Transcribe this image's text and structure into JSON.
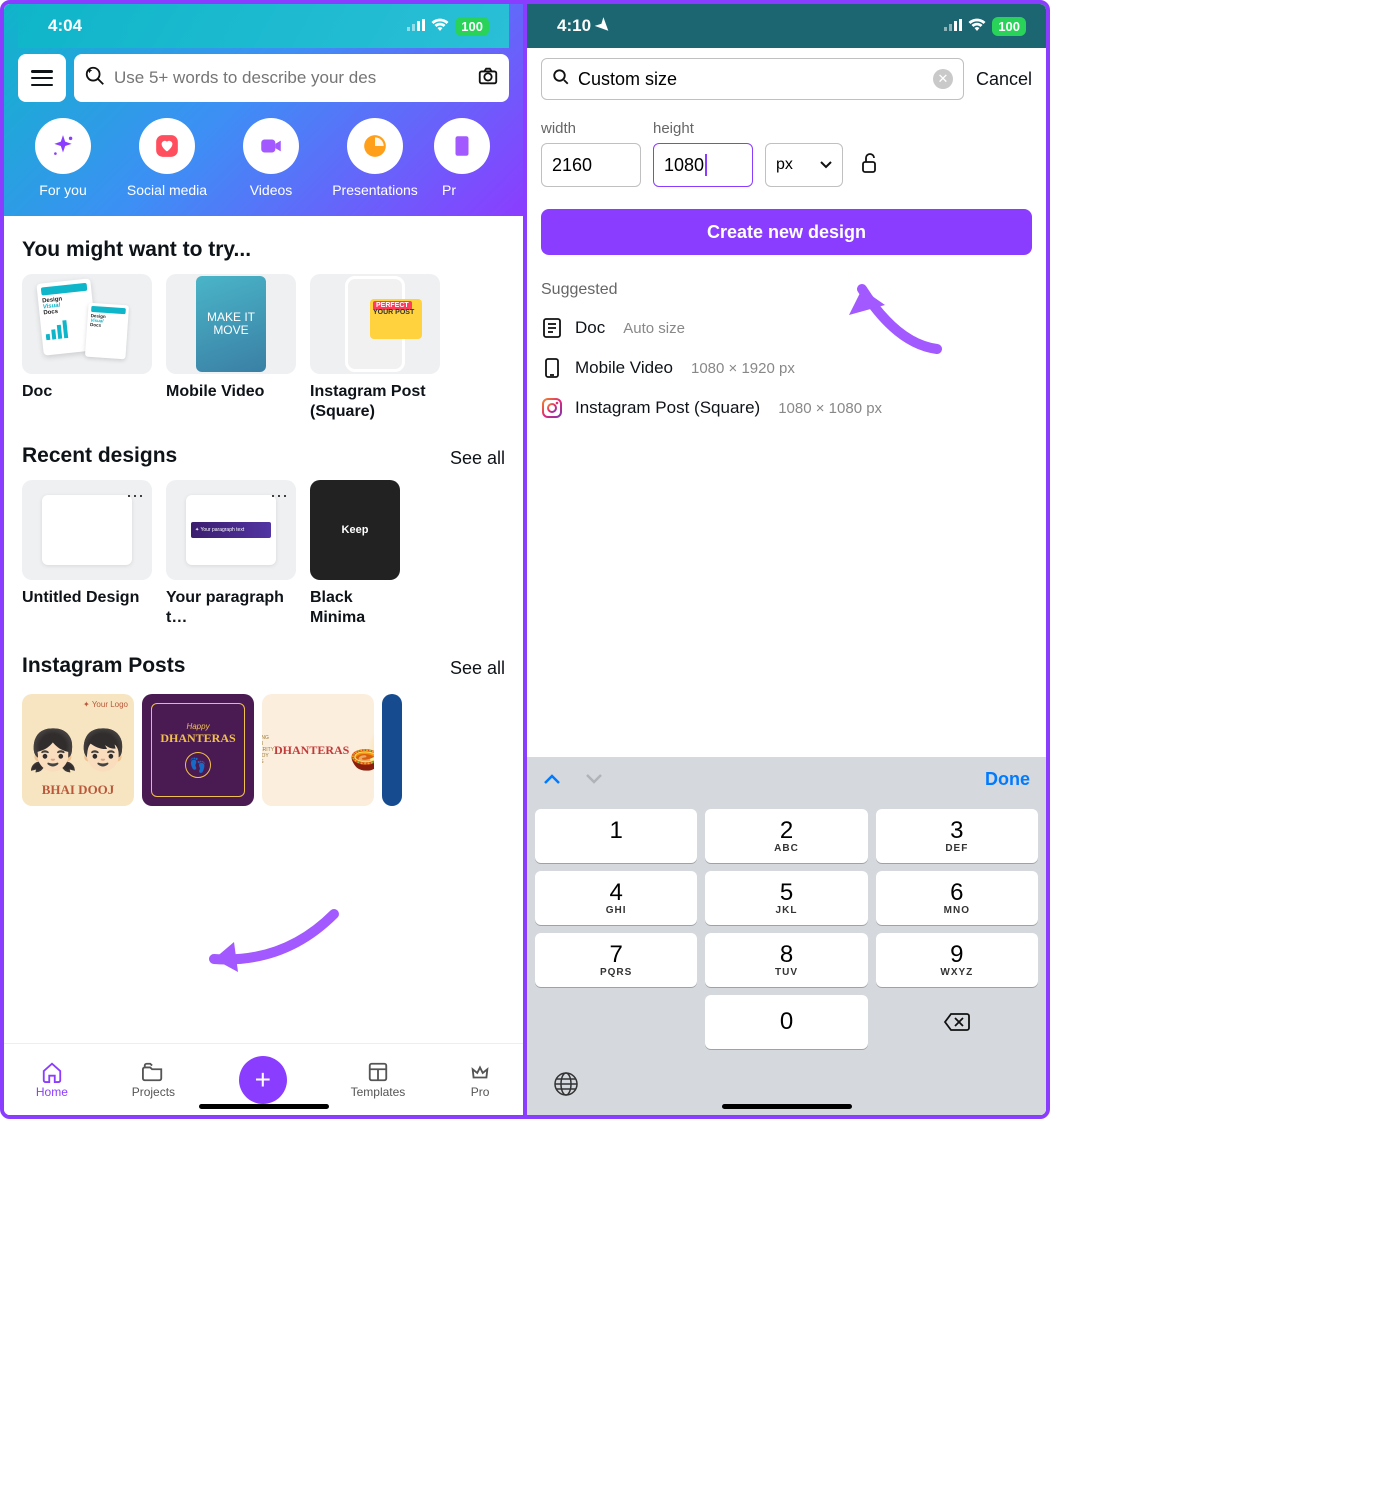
{
  "left": {
    "status": {
      "time": "4:04",
      "battery": "100"
    },
    "search_placeholder": "Use 5+ words to describe your des",
    "categories": [
      {
        "label": "For you",
        "name": "cat-foryou",
        "icon": "sparkle",
        "color": "#8b3dff"
      },
      {
        "label": "Social media",
        "name": "cat-social",
        "icon": "heart",
        "color": "#ff4f5e"
      },
      {
        "label": "Videos",
        "name": "cat-videos",
        "icon": "video",
        "color": "#a259ff"
      },
      {
        "label": "Presentations",
        "name": "cat-present",
        "icon": "present",
        "color": "#ff9f1a"
      },
      {
        "label": "Pr",
        "name": "cat-print",
        "icon": "print",
        "color": "#a259ff"
      }
    ],
    "try_title": "You might want to try...",
    "try_items": [
      {
        "label": "Doc",
        "name": "try-doc"
      },
      {
        "label": "Mobile Video",
        "name": "try-mobile-video"
      },
      {
        "label": "Instagram Post (Square)",
        "name": "try-ig-square"
      }
    ],
    "recent_title": "Recent designs",
    "see_all": "See all",
    "recent_items": [
      {
        "label": "Untitled Design",
        "name": "recent-untitled"
      },
      {
        "label": "Your paragraph t…",
        "name": "recent-paragraph"
      },
      {
        "label": "Black Minima",
        "name": "recent-black"
      }
    ],
    "ig_title": "Instagram Posts",
    "ig_items": [
      {
        "label": "BHAI DOOJ",
        "name": "ig-bhai",
        "bg": "#f7e5c1",
        "fg": "#b9583a"
      },
      {
        "label": "DHANTERAS",
        "name": "ig-dhanteras",
        "bg": "#4a1b52",
        "fg": "#f1c14b",
        "sub": "Happy"
      },
      {
        "label": "DHANTERAS",
        "name": "ig-dhanteras2",
        "bg": "#fbeedd",
        "fg": "#c33a3a",
        "sub": "WISHING YOU PROSPERITY AND JOY THIS"
      },
      {
        "label": "",
        "name": "ig-extra",
        "bg": "#164c8f",
        "fg": "#fff"
      }
    ],
    "nav": {
      "home": "Home",
      "projects": "Projects",
      "templates": "Templates",
      "pro": "Pro"
    }
  },
  "right": {
    "status": {
      "time": "4:10",
      "battery": "100"
    },
    "search_value": "Custom size",
    "cancel": "Cancel",
    "width_label": "width",
    "height_label": "height",
    "width_value": "2160",
    "height_value": "1080",
    "unit": "px",
    "create_label": "Create new design",
    "suggested_title": "Suggested",
    "suggested": [
      {
        "name": "sug-doc",
        "label": "Doc",
        "meta": "Auto size",
        "icon": "doc"
      },
      {
        "name": "sug-mobile-video",
        "label": "Mobile Video",
        "meta": "1080 × 1920 px",
        "icon": "mobile"
      },
      {
        "name": "sug-ig-square",
        "label": "Instagram Post (Square)",
        "meta": "1080 × 1080 px",
        "icon": "ig"
      }
    ],
    "kb": {
      "done": "Done",
      "keys": [
        {
          "n": "1",
          "l": ""
        },
        {
          "n": "2",
          "l": "ABC"
        },
        {
          "n": "3",
          "l": "DEF"
        },
        {
          "n": "4",
          "l": "GHI"
        },
        {
          "n": "5",
          "l": "JKL"
        },
        {
          "n": "6",
          "l": "MNO"
        },
        {
          "n": "7",
          "l": "PQRS"
        },
        {
          "n": "8",
          "l": "TUV"
        },
        {
          "n": "9",
          "l": "WXYZ"
        }
      ],
      "zero": "0"
    }
  }
}
